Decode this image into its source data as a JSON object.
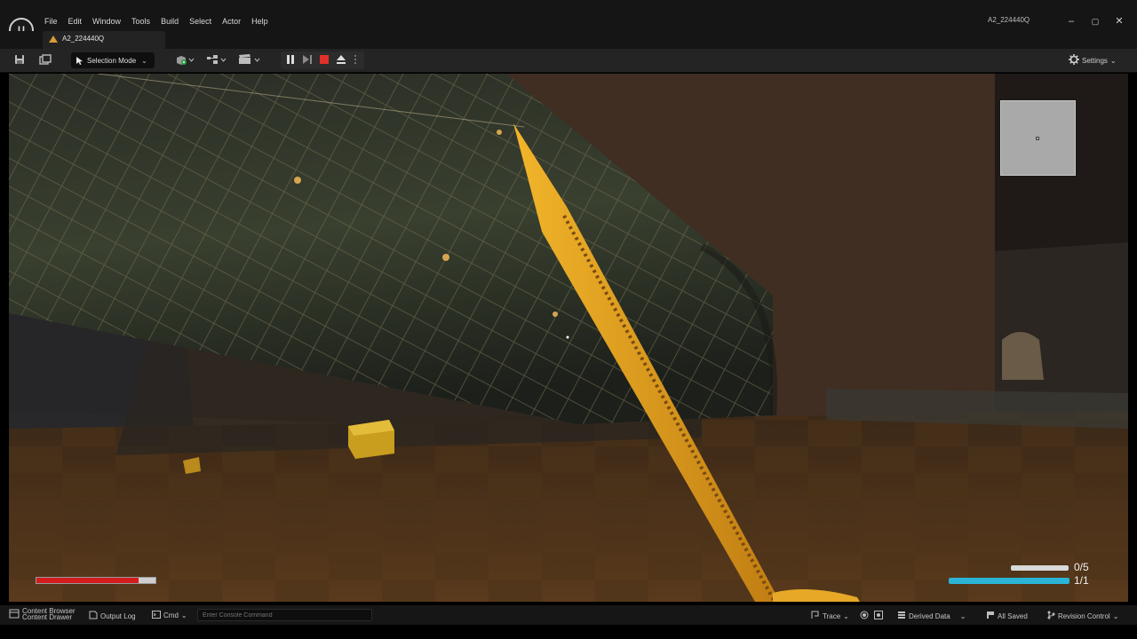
{
  "app": {
    "window_title": "A2_224440Q",
    "doc_tab_label": "A2_224440Q",
    "logo_text": "U"
  },
  "menu": [
    "File",
    "Edit",
    "Window",
    "Tools",
    "Build",
    "Select",
    "Actor",
    "Help"
  ],
  "window_controls": {
    "minimize": "–",
    "maximize": "▢",
    "close": "✕"
  },
  "toolbar": {
    "selection_mode_label": "Selection Mode",
    "settings_label": "Settings",
    "icons": [
      "save-icon",
      "content-icon",
      "add-actor-icon",
      "blueprint-icon",
      "cinematics-icon",
      "pause-icon",
      "advance-frame-icon",
      "stop-icon",
      "eject-icon",
      "more-options-icon",
      "settings-gear-icon"
    ]
  },
  "hud": {
    "health_fraction": 0.86,
    "ammo_fraction": 0.98,
    "mana_fraction": 1.0,
    "ammo_count": "0/5",
    "mana_count": "1/1",
    "colors": {
      "health": "#d41c1c",
      "mana": "#2bb4d6",
      "ammo": "#d9d9d9"
    }
  },
  "statusbar": {
    "content_browser_label": "Content Browser",
    "content_drawer_label": "Content Drawer",
    "output_log_label": "Output Log",
    "cmd_label": "Cmd",
    "console_placeholder": "Enter Console Command",
    "trace_label": "Trace",
    "derived_data_label": "Derived Data",
    "all_saved_label": "All Saved",
    "revision_control_label": "Revision Control"
  },
  "colors": {
    "accent_orange": "#e0a12a",
    "stop_red": "#e0302a"
  }
}
